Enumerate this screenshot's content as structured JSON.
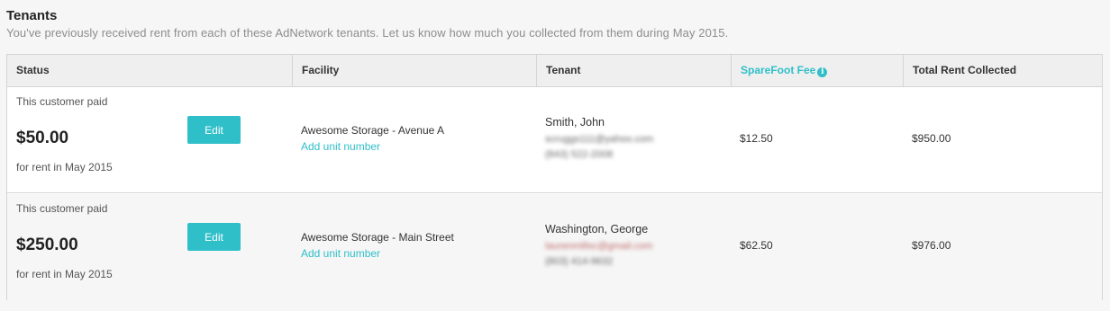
{
  "section": {
    "title": "Tenants",
    "subtitle": "You've previously received rent from each of these AdNetwork tenants. Let us know how much you collected from them during May 2015."
  },
  "table": {
    "headers": {
      "status": "Status",
      "facility": "Facility",
      "tenant": "Tenant",
      "fee": "SpareFoot Fee",
      "fee_icon": "info-icon",
      "total": "Total Rent Collected"
    },
    "rows": [
      {
        "paid_label": "This customer paid",
        "amount": "$50.00",
        "for_rent": "for rent in May 2015",
        "edit_label": "Edit",
        "facility": "Awesome Storage - Avenue A",
        "unit_link": "Add unit number",
        "tenant_name": "Smith, John",
        "tenant_email": "scruggs111@yahoo.com",
        "tenant_phone": "(843) 522-2008",
        "fee": "$12.50",
        "total": "$950.00"
      },
      {
        "paid_label": "This customer paid",
        "amount": "$250.00",
        "for_rent": "for rent in May 2015",
        "edit_label": "Edit",
        "facility": "Awesome Storage - Main Street",
        "unit_link": "Add unit number",
        "tenant_name": "Washington, George",
        "tenant_email": "laurenmillsc@gmail.com",
        "tenant_phone": "(803) 414-9632",
        "fee": "$62.50",
        "total": "$976.00"
      }
    ]
  },
  "colors": {
    "accent": "#2fbfc9",
    "header_bg": "#efefef",
    "border": "#d5d5d5",
    "alt_row_bg": "#f6f6f6"
  }
}
